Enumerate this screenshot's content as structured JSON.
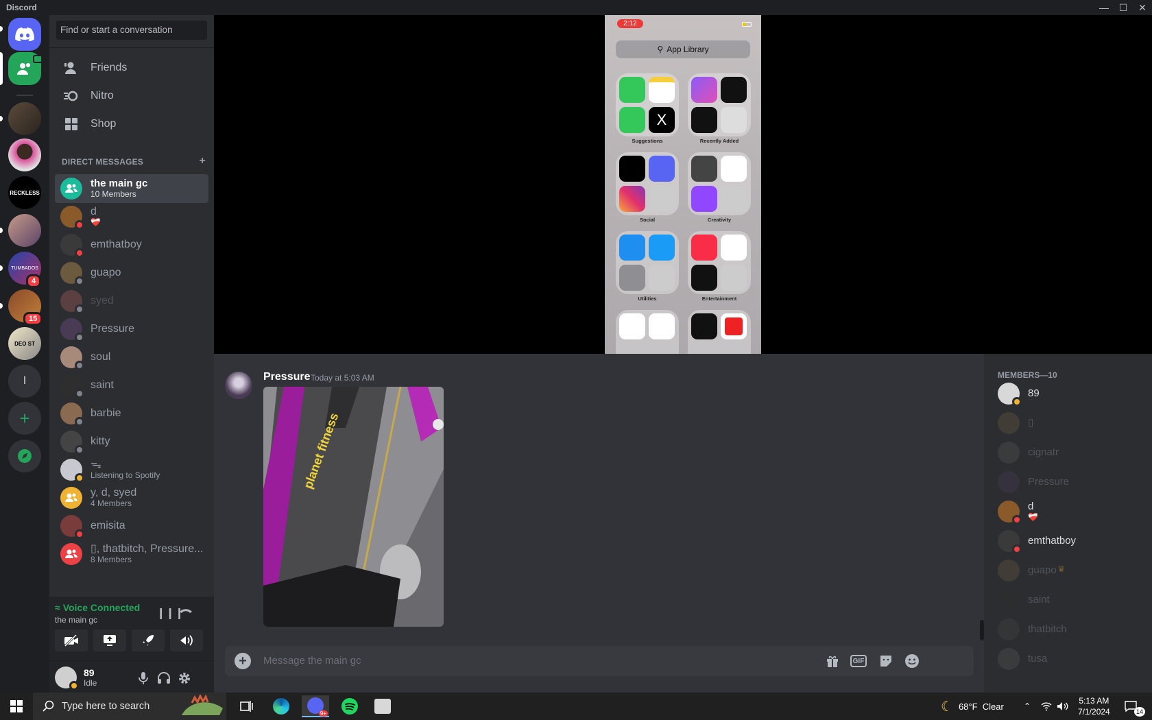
{
  "window": {
    "title": "Discord",
    "controls": [
      "minimize",
      "maximize",
      "close"
    ]
  },
  "guilds": {
    "unread_badges": [
      "4",
      "15"
    ],
    "text_server_letter": "l"
  },
  "dm_sidebar": {
    "search_placeholder": "Find or start a conversation",
    "nav": [
      {
        "label": "Friends"
      },
      {
        "label": "Nitro"
      },
      {
        "label": "Shop"
      }
    ],
    "header": "DIRECT MESSAGES",
    "items": [
      {
        "name": "the main gc",
        "sub": "10 Members",
        "color": "#1abc9c",
        "selected": true,
        "group": true
      },
      {
        "name": "d",
        "sub": "❤️‍🩹",
        "color": "#8b5a2b",
        "status": "#f23f43"
      },
      {
        "name": "emthatboy",
        "sub": "",
        "color": "#3a3a3a",
        "status": "#f23f43"
      },
      {
        "name": "guapo",
        "sub": "",
        "color": "#6b5a3e",
        "status": "#80848e"
      },
      {
        "name": "syed",
        "sub": "",
        "color": "#5a4040",
        "status": "#80848e",
        "dim": true
      },
      {
        "name": "Pressure",
        "sub": "",
        "color": "#4a3b55",
        "status": "#80848e"
      },
      {
        "name": "soul",
        "sub": "",
        "color": "#a78a7a",
        "status": "#80848e"
      },
      {
        "name": "saint",
        "sub": "",
        "color": "#2e2e2e",
        "status": "#80848e"
      },
      {
        "name": "barbie",
        "sub": "",
        "color": "#8a6a50",
        "status": "#80848e"
      },
      {
        "name": "kitty",
        "sub": "",
        "color": "#444",
        "status": "#80848e"
      },
      {
        "name": "ᯓ",
        "sub": "Listening to Spotify",
        "color": "#c8c8d0",
        "status": "#f0b232"
      },
      {
        "name": "y, d, syed",
        "sub": "4 Members",
        "color": "#f0b232",
        "group": true
      },
      {
        "name": "emisita",
        "sub": "",
        "color": "#7a3b3b",
        "status": "#f23f43"
      },
      {
        "name": "▯, thatbitch, Pressure...",
        "sub": "8 Members",
        "color": "#ed4245",
        "group": true
      }
    ]
  },
  "voice": {
    "title": "Voice Connected",
    "channel": "the main gc"
  },
  "user": {
    "name": "89",
    "status": "Idle"
  },
  "stream": {
    "phone_time": "2:12",
    "search_label": "App Library",
    "folders": [
      "Suggestions",
      "Recently Added",
      "Social",
      "Creativity",
      "Utilities",
      "Entertainment"
    ]
  },
  "message": {
    "author": "Pressure",
    "timestamp": "Today at 5:03 AM",
    "image_text": "planet fitness"
  },
  "composer": {
    "placeholder": "Message the main gc",
    "gif_label": "GIF"
  },
  "members": {
    "header": "MEMBERS—10",
    "list": [
      {
        "name": "89",
        "color": "#d8d8d8",
        "status": "#f0b232",
        "offline": false
      },
      {
        "name": "▯",
        "color": "#6b5a3e",
        "offline": true
      },
      {
        "name": "cignatr",
        "color": "#555",
        "offline": true
      },
      {
        "name": "Pressure",
        "color": "#4a3b55",
        "offline": true
      },
      {
        "name": "d",
        "sub": "❤️‍🩹",
        "color": "#8b5a2b",
        "status": "#f23f43",
        "offline": false
      },
      {
        "name": "emthatboy",
        "color": "#3a3a3a",
        "status": "#f23f43",
        "offline": false
      },
      {
        "name": "guapo",
        "color": "#6b5a3e",
        "offline": true,
        "crown": true
      },
      {
        "name": "saint",
        "color": "#2e2e2e",
        "offline": true
      },
      {
        "name": "thatbitch",
        "color": "#444",
        "offline": true
      },
      {
        "name": "tusa",
        "color": "#555",
        "offline": true
      }
    ]
  },
  "taskbar": {
    "search_placeholder": "Type here to search",
    "weather": "68°F  Clear",
    "time": "5:13 AM",
    "date": "7/1/2024",
    "notifications": "14"
  }
}
